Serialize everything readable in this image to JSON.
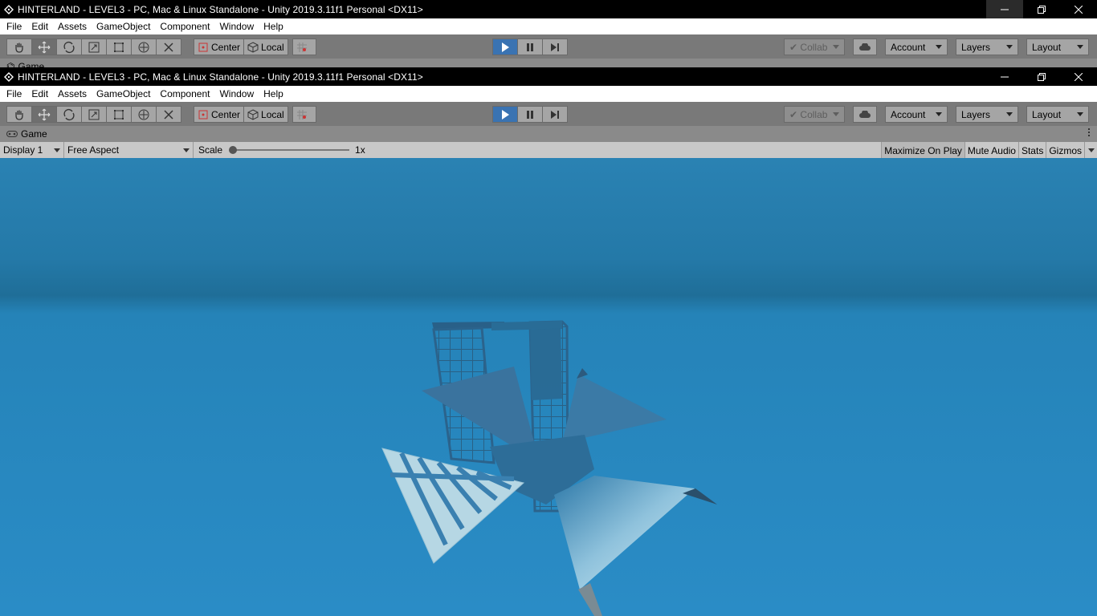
{
  "window": {
    "title": "HINTERLAND - LEVEL3 - PC, Mac & Linux Standalone - Unity 2019.3.11f1 Personal <DX11>",
    "controls": [
      "minimize",
      "restore",
      "close"
    ]
  },
  "menu": [
    "File",
    "Edit",
    "Assets",
    "GameObject",
    "Component",
    "Window",
    "Help"
  ],
  "toolbar": {
    "tools": [
      "hand-tool",
      "move-tool",
      "rotate-tool",
      "scale-tool",
      "rect-tool",
      "transform-tool",
      "custom-tool"
    ],
    "active_tool": "move-tool",
    "pivot_mode": "Center",
    "pivot_rotation": "Local",
    "play_state": "playing",
    "collab": "Collab",
    "account": "Account",
    "layers": "Layers",
    "layout": "Layout"
  },
  "game_view": {
    "tab_label": "Game",
    "display": "Display 1",
    "aspect": "Free Aspect",
    "scale_label": "Scale",
    "scale_value": "1x",
    "maximize_on_play": "Maximize On Play",
    "mute_audio": "Mute Audio",
    "stats": "Stats",
    "gizmos": "Gizmos"
  },
  "colors": {
    "sky_top": "#2980b0",
    "sky_horizon": "#1f6e98",
    "ground": "#2a8ac4",
    "play_active": "#3a73b2"
  }
}
